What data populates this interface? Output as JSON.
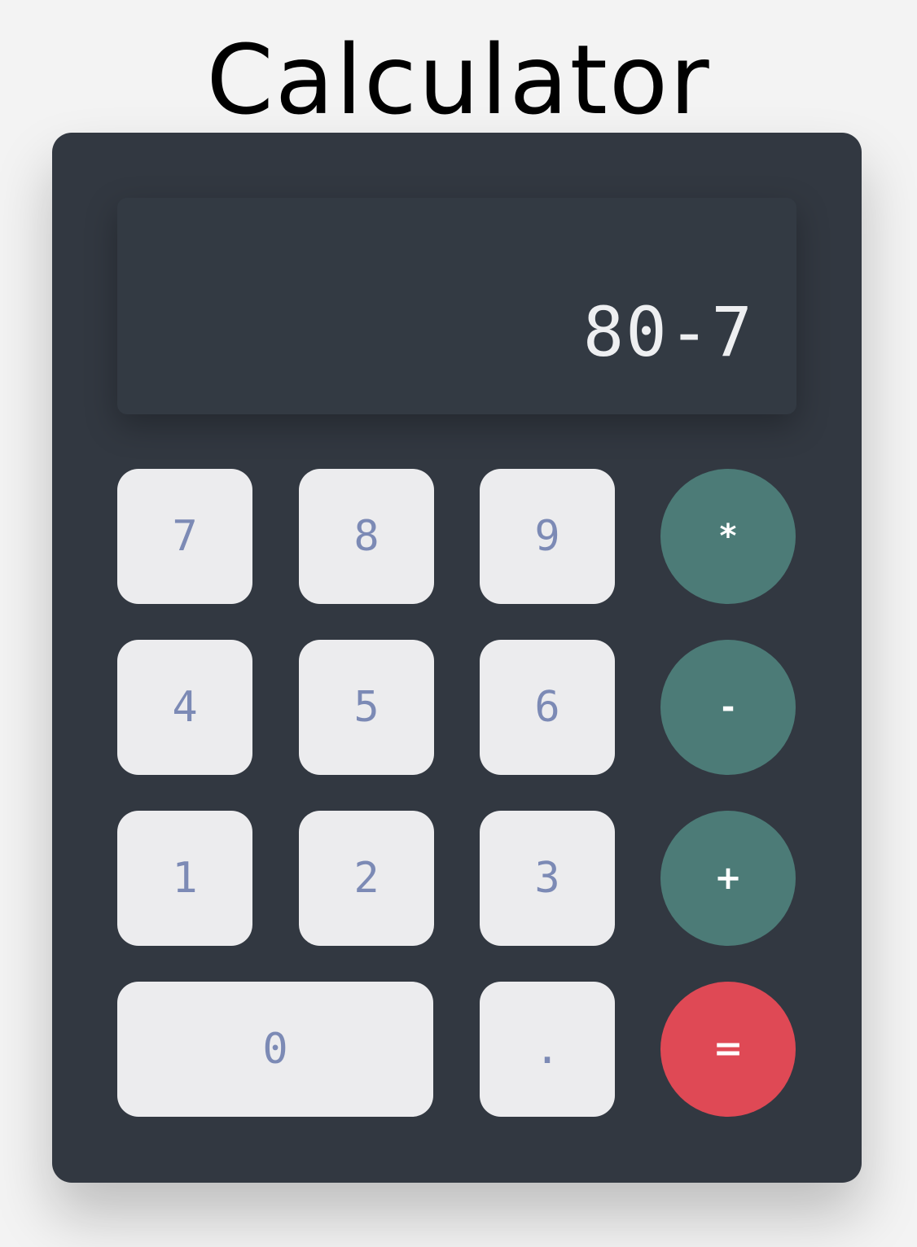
{
  "page": {
    "title": "Calculator"
  },
  "display": {
    "value": "80-7"
  },
  "keys": {
    "seven": "7",
    "eight": "8",
    "nine": "9",
    "multiply": "*",
    "four": "4",
    "five": "5",
    "six": "6",
    "subtract": "-",
    "one": "1",
    "two": "2",
    "three": "3",
    "add": "+",
    "zero": "0",
    "decimal": ".",
    "equals": "="
  },
  "colors": {
    "background": "#f3f3f3",
    "calculator_body": "#323841",
    "digit_key": "#ececee",
    "digit_text": "#7c8ab5",
    "operator_key": "#4c7b77",
    "equals_key": "#df4955",
    "display_text": "#eeeff1"
  }
}
